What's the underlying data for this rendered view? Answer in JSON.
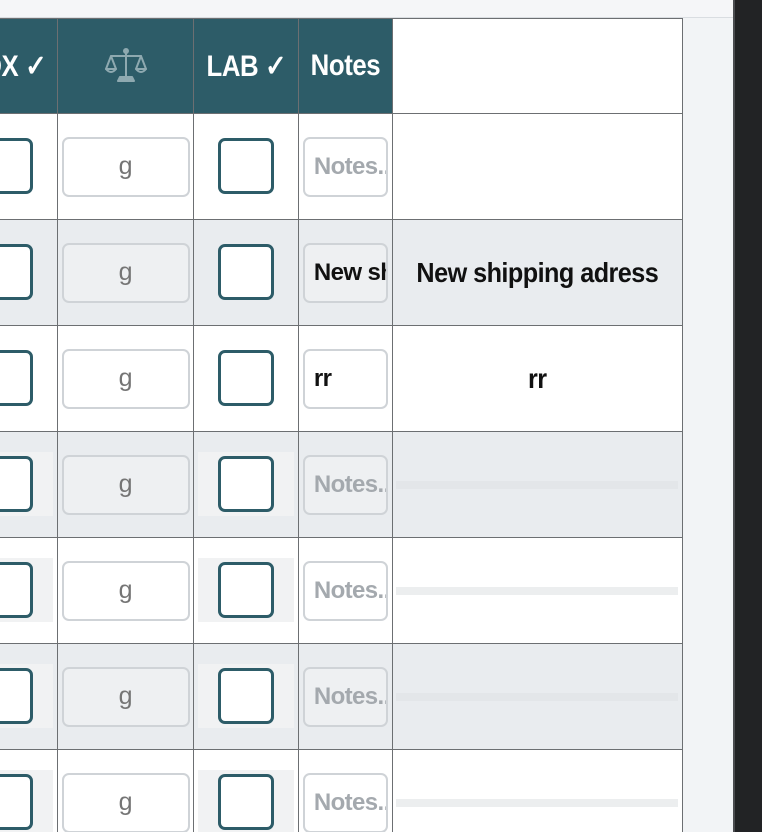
{
  "headers": {
    "box_check": "BOX ✓",
    "weight_icon": "balance-scale-icon",
    "lab_check": "LAB ✓",
    "notes": "Notes",
    "extra": ""
  },
  "placeholders": {
    "weight": "g",
    "notes": "Notes..."
  },
  "rows": [
    {
      "notes_value": "",
      "extra_text": ""
    },
    {
      "notes_value": "New shipping adress",
      "extra_text": "New shipping adress"
    },
    {
      "notes_value": "rr",
      "extra_text": "rr"
    },
    {
      "notes_value": "",
      "extra_text": ""
    },
    {
      "notes_value": "",
      "extra_text": ""
    },
    {
      "notes_value": "",
      "extra_text": ""
    },
    {
      "notes_value": "",
      "extra_text": ""
    }
  ],
  "colors": {
    "header_bg": "#2d5c68",
    "row_alt_bg": "#e9ecef",
    "checkbox_border": "#2d5c68"
  }
}
